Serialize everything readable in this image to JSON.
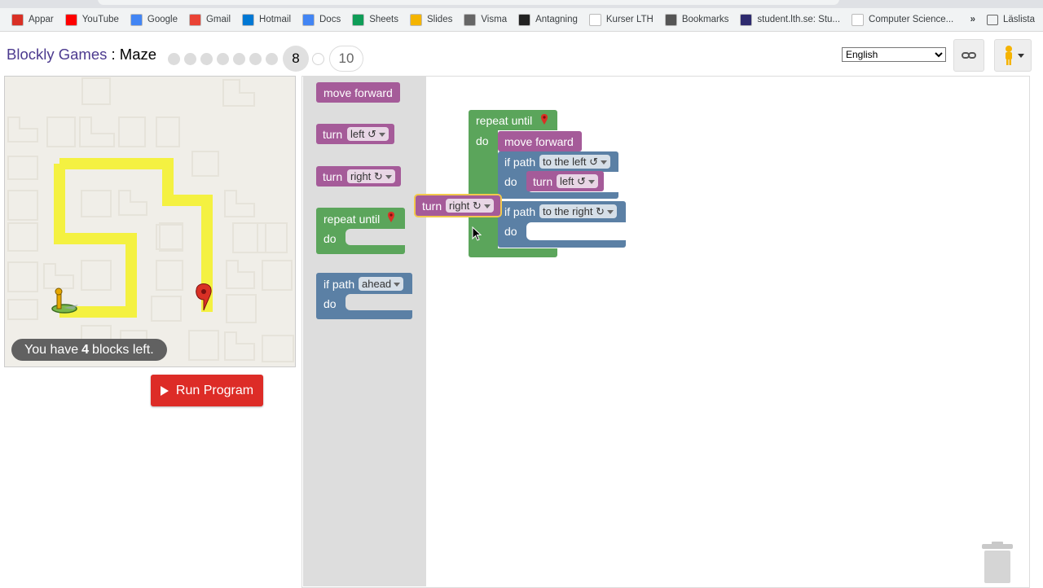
{
  "browser": {
    "bookmarks": [
      {
        "label": "Appar",
        "icon": "apps-grid-icon",
        "color": "#d93025"
      },
      {
        "label": "YouTube",
        "icon": "youtube-icon",
        "color": "#ff0000"
      },
      {
        "label": "Google",
        "icon": "google-icon",
        "color": "#4285f4"
      },
      {
        "label": "Gmail",
        "icon": "gmail-icon",
        "color": "#ea4335"
      },
      {
        "label": "Hotmail",
        "icon": "outlook-icon",
        "color": "#0078d4"
      },
      {
        "label": "Docs",
        "icon": "docs-icon",
        "color": "#4285f4"
      },
      {
        "label": "Sheets",
        "icon": "sheets-icon",
        "color": "#0f9d58"
      },
      {
        "label": "Slides",
        "icon": "slides-icon",
        "color": "#f4b400"
      },
      {
        "label": "Visma",
        "icon": "visma-icon",
        "color": "#666666"
      },
      {
        "label": "Antagning",
        "icon": "antagning-icon",
        "color": "#222222"
      },
      {
        "label": "Kurser LTH",
        "icon": "lu-icon",
        "color": "#ffffff"
      },
      {
        "label": "Bookmarks",
        "icon": "star-icon",
        "color": "#555555"
      },
      {
        "label": "student.lth.se: Stu...",
        "icon": "lu-icon",
        "color": "#2d2a6e"
      },
      {
        "label": "Computer Science...",
        "icon": "lu-icon",
        "color": "#ffffff"
      }
    ],
    "more": "»",
    "reading_list": "Läslista"
  },
  "header": {
    "game": "Blockly Games",
    "separator": " : ",
    "app": "Maze",
    "current_level": "8",
    "last_level": "10",
    "language": "English"
  },
  "maze": {
    "capacity_prefix": "You have",
    "capacity_count": "4",
    "capacity_suffix": "blocks left."
  },
  "run_button": "Run Program",
  "flyout": {
    "move_forward": "move forward",
    "turn": "turn",
    "left": "left ↺",
    "right": "right ↻",
    "repeat_until": "repeat until",
    "do": "do",
    "if_path": "if path",
    "ahead": "ahead"
  },
  "workspace": {
    "repeat_until": "repeat until",
    "do": "do",
    "move_forward": "move forward",
    "if_path": "if path",
    "to_the_left": "to the left ↺",
    "to_the_right": "to the right ↻",
    "turn": "turn",
    "left": "left ↺",
    "right": "right ↻"
  },
  "colors": {
    "move_block": "#a55b99",
    "loop_block": "#5ba55b",
    "logic_block": "#5b80a5",
    "run_button": "#dd2c27",
    "path": "#f4f141"
  }
}
